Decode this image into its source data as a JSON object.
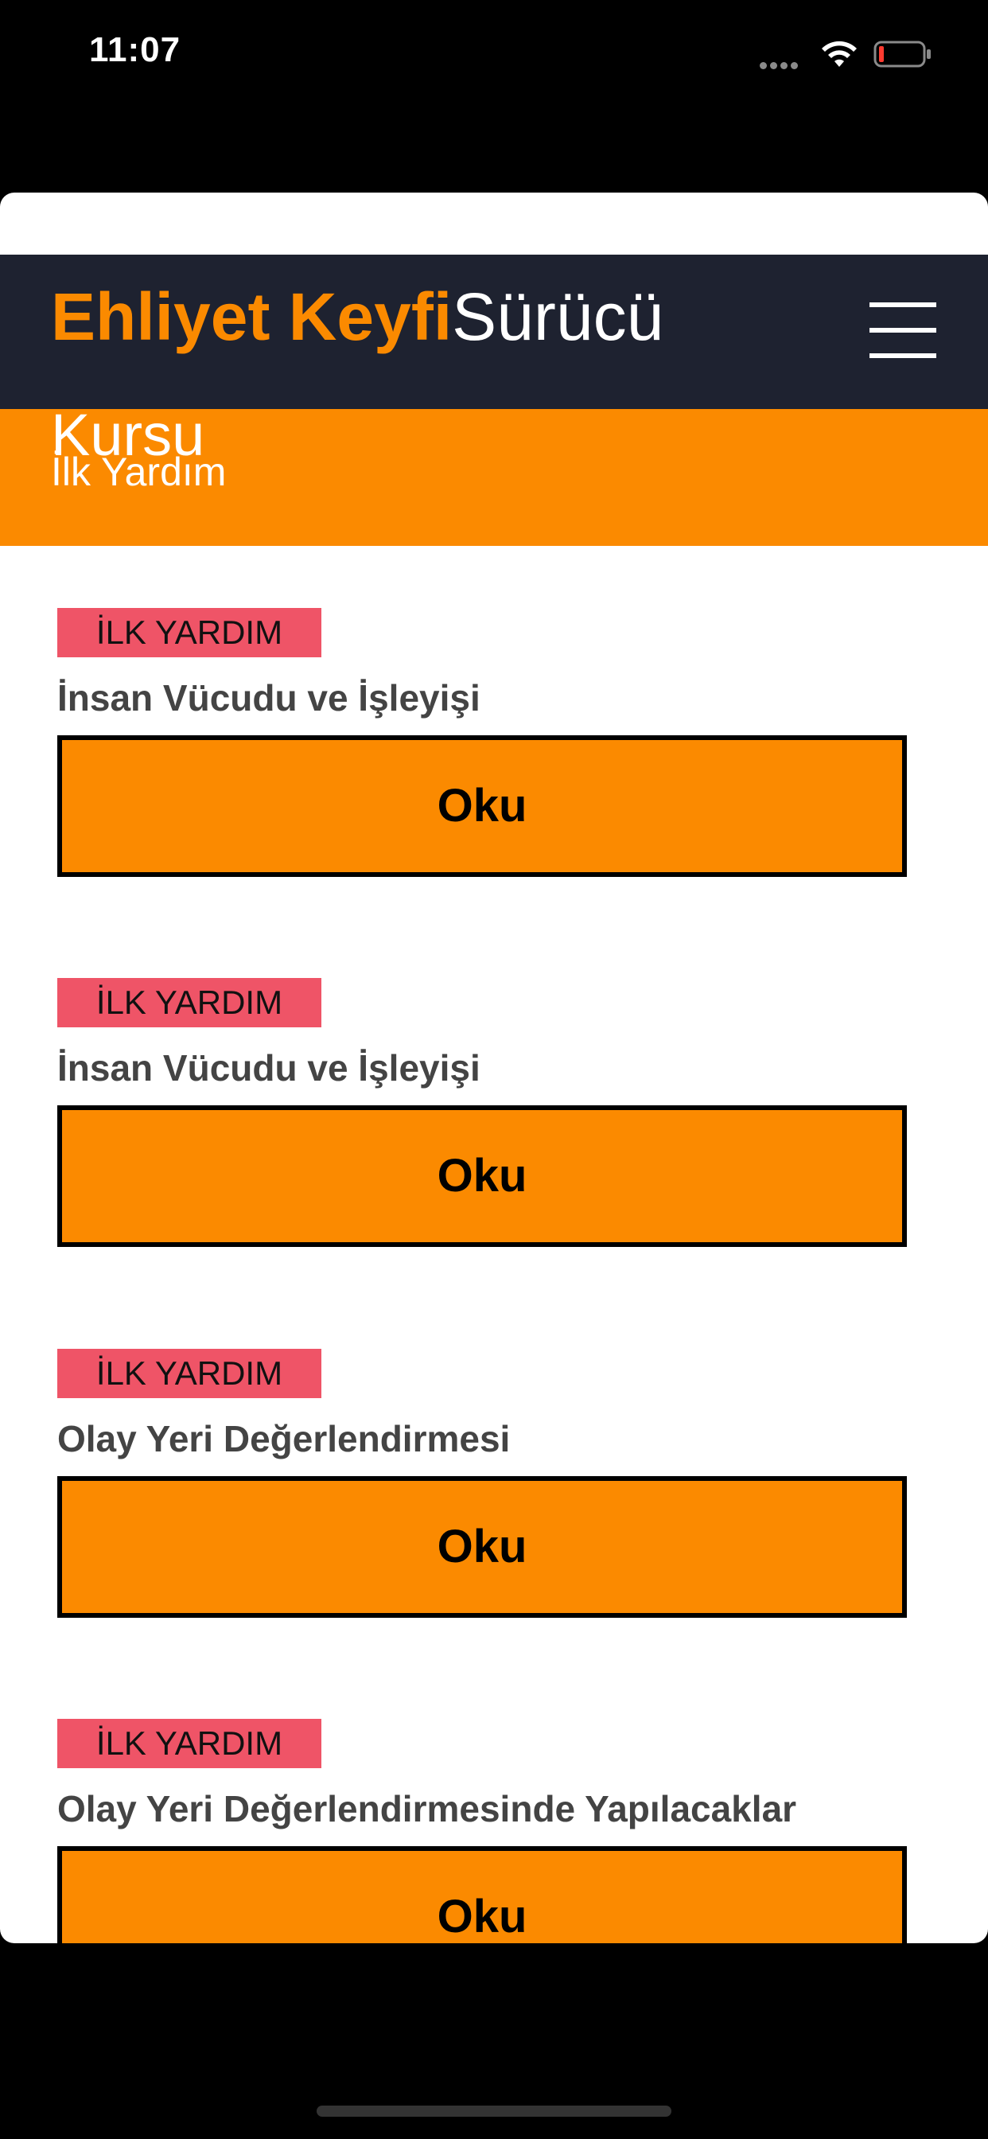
{
  "status_bar": {
    "time": "11:07",
    "icons": [
      "signal-dots-icon",
      "wifi-icon",
      "battery-low-icon"
    ]
  },
  "header": {
    "brand_bold": "Ehliyet Keyfi",
    "brand_light": "Sürücü",
    "menu_icon": "hamburger-menu-icon"
  },
  "subtitle": {
    "line1": "Kursu",
    "line2": "İlk Yardım"
  },
  "lessons": [
    {
      "tag": "İLK YARDIM",
      "title": "İnsan Vücudu ve İşleyişi",
      "button": "Oku"
    },
    {
      "tag": "İLK YARDIM",
      "title": "İnsan Vücudu ve İşleyişi",
      "button": "Oku"
    },
    {
      "tag": "İLK YARDIM",
      "title": "Olay Yeri Değerlendirmesi",
      "button": "Oku"
    },
    {
      "tag": "İLK YARDIM",
      "title": "Olay Yeri Değerlendirmesinde Yapılacaklar",
      "button": "Oku"
    }
  ],
  "colors": {
    "nav_bg": "#1e2230",
    "accent_orange": "#fb8a00",
    "tag_red": "#ef5467"
  }
}
